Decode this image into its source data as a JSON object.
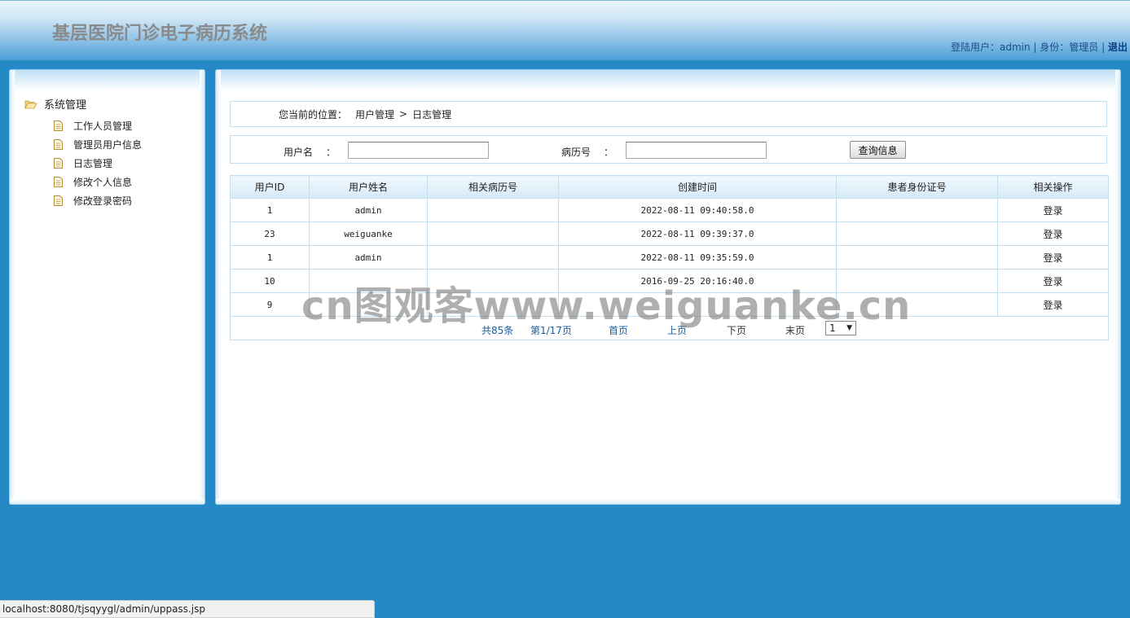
{
  "header": {
    "app_title": "基层医院门诊电子病历系统",
    "user_label": "登陆用户：",
    "user_name": "admin",
    "separator": " | ",
    "role_label": "身份：",
    "role_name": "管理员",
    "logout": "退出"
  },
  "sidebar": {
    "root_label": "系统管理",
    "items": [
      {
        "label": "工作人员管理"
      },
      {
        "label": "管理员用户信息"
      },
      {
        "label": "日志管理"
      },
      {
        "label": "修改个人信息"
      },
      {
        "label": "修改登录密码"
      }
    ]
  },
  "breadcrumb": {
    "prefix": "您当前的位置：",
    "level1": "用户管理",
    "sep": ">",
    "level2": "日志管理"
  },
  "search": {
    "username_label": "用户名",
    "record_label": "病历号",
    "colon": "：",
    "username_value": "",
    "record_value": "",
    "button": "查询信息"
  },
  "table": {
    "headers": [
      "用户ID",
      "用户姓名",
      "相关病历号",
      "创建时间",
      "患者身份证号",
      "相关操作"
    ],
    "rows": [
      {
        "id": "1",
        "name": "admin",
        "record": "",
        "time": "2022-08-11 09:40:58.0",
        "idcard": "",
        "op": "登录"
      },
      {
        "id": "23",
        "name": "weiguanke",
        "record": "",
        "time": "2022-08-11 09:39:37.0",
        "idcard": "",
        "op": "登录"
      },
      {
        "id": "1",
        "name": "admin",
        "record": "",
        "time": "2022-08-11 09:35:59.0",
        "idcard": "",
        "op": "登录"
      },
      {
        "id": "10",
        "name": "",
        "record": "",
        "time": "2016-09-25 20:16:40.0",
        "idcard": "",
        "op": "登录"
      },
      {
        "id": "9",
        "name": "",
        "record": "",
        "time": "",
        "idcard": "",
        "op": "登录"
      }
    ]
  },
  "pager": {
    "total": "共85条",
    "page": "第1/17页",
    "first": "首页",
    "prev": "上页",
    "next": "下页",
    "last": "末页",
    "selected_page": "1"
  },
  "watermark": "cn图观客www.weiguanke.cn",
  "status_bar": "localhost:8080/tjsqyygl/admin/uppass.jsp",
  "colors": {
    "background": "#2589c5",
    "link_blue": "#1b5b9a",
    "table_border": "#c5def0"
  }
}
